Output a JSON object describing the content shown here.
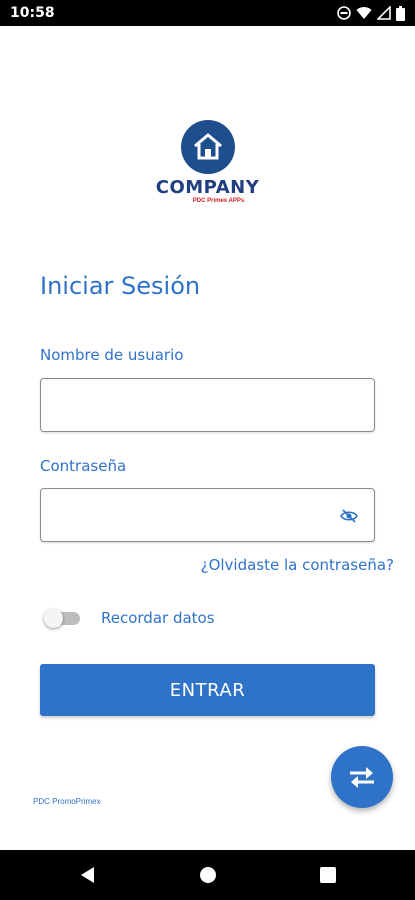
{
  "status_bar": {
    "time": "10:58",
    "icons": [
      "do-not-disturb-icon",
      "wifi-icon",
      "signal-icon",
      "battery-icon"
    ]
  },
  "logo": {
    "name": "COMPANY",
    "subtitle": "PDC Primex APPs",
    "brand_color": "#1f4e8f",
    "accent_color": "#d32020"
  },
  "form": {
    "title": "Iniciar Sesión",
    "username_label": "Nombre de usuario",
    "username_value": "",
    "password_label": "Contraseña",
    "password_value": "",
    "forgot_link": "¿Olvidaste la contraseña?",
    "remember_label": "Recordar datos",
    "remember_checked": false,
    "submit_label": "ENTRAR",
    "accent_color": "#2f73c8"
  },
  "fab": {
    "icon": "swap-arrows-icon"
  },
  "footer": {
    "caption": "PDC PromoPrimex"
  },
  "nav_bar": {
    "icons": [
      "back-icon",
      "home-icon",
      "recents-icon"
    ]
  }
}
